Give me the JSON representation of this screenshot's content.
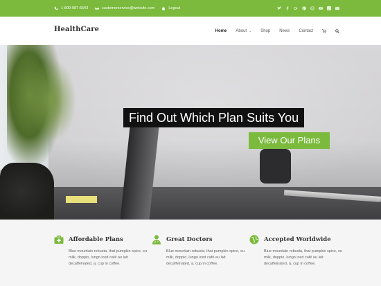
{
  "topbar": {
    "phone": "1-800-987-6543",
    "email": "customerservice@website.com",
    "logout": "Logout",
    "social_icons": [
      "twitter-icon",
      "facebook-icon",
      "googleplus-icon",
      "pinterest-icon",
      "dribbble-icon",
      "youtube-icon",
      "rss-icon",
      "mail-icon"
    ],
    "color": "#7bba3c"
  },
  "header": {
    "logo": "HealthCare",
    "nav": [
      {
        "label": "Home",
        "active": true
      },
      {
        "label": "About",
        "has_dropdown": true
      },
      {
        "label": "Shop"
      },
      {
        "label": "News"
      },
      {
        "label": "Contact"
      }
    ]
  },
  "hero": {
    "title": "Find Out Which Plan Suits You",
    "button": "View Our Plans"
  },
  "features": [
    {
      "icon": "briefcase-medical-icon",
      "title": "Affordable Plans",
      "text": "Blue mountain robusta, that pumpkin spice, eu milk, doppio, lungo iced café au lait decaffeinated, a, cup in coffee."
    },
    {
      "icon": "doctor-icon",
      "title": "Great Doctors",
      "text": "Blue mountain robusta, that pumpkin spice, eu milk, doppio, lungo iced café au lait decaffeinated, a, cup in coffee."
    },
    {
      "icon": "globe-icon",
      "title": "Accepted Worldwide",
      "text": "Blue mountain robusta, that pumpkin spice, eu milk, doppio, lungo iced café au lait decaffeinated, a, cup in coffee."
    }
  ]
}
